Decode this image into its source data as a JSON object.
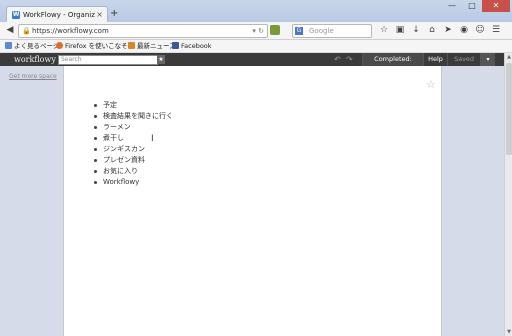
{
  "browser": {
    "tab_title": "WorkFlowy - Organize y...",
    "tab_favicon": "W",
    "tab_close": "×",
    "new_tab": "+",
    "window_controls": {
      "minimize": "—",
      "maximize": "□",
      "close": "✕"
    },
    "url": "https://workflowy.com",
    "search_placeholder": "Google",
    "search_engine_letter": "G",
    "bookmarks": [
      {
        "label": "よく見るページ",
        "color": "#5a8ad6"
      },
      {
        "label": "Firefox を使いこなそう",
        "color": "#e06b2a"
      },
      {
        "label": "最新ニュース",
        "color": "#d9852b"
      },
      {
        "label": "Facebook",
        "color": "#3b5998"
      }
    ]
  },
  "app": {
    "logo": "workflowy",
    "search_placeholder": "Search",
    "star_glyph": "★",
    "undo_glyph": "↶",
    "redo_glyph": "↷",
    "completed_label": "Completed: Visible",
    "help_label": "Help",
    "saved_label": "Saved",
    "menu_glyph": "▾",
    "left_link": "Get more space",
    "page_star_glyph": "☆",
    "items": [
      "予定",
      "検査結果を聞きに行く",
      "ラーメン",
      "煮干し",
      "ジンギスカン",
      "プレゼン資料",
      "お気に入り",
      "Workflowy"
    ]
  }
}
